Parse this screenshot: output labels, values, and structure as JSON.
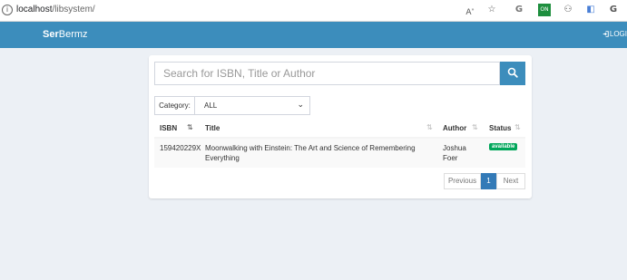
{
  "browser": {
    "url_host": "localhost",
    "url_path": "/libsystem/"
  },
  "navbar": {
    "brand_bold": "Ser",
    "brand_rest": "Bermz",
    "login_label": "LOGI"
  },
  "search": {
    "placeholder": "Search for ISBN, Title or Author"
  },
  "category": {
    "label": "Category:",
    "selected": "ALL"
  },
  "table": {
    "headers": [
      "ISBN",
      "Title",
      "Author",
      "Status"
    ],
    "rows": [
      {
        "isbn": "159420229X",
        "title": "Moonwalking with Einstein: The Art and Science of Remembering Everything",
        "author": "Joshua Foer",
        "status": "available"
      }
    ]
  },
  "pagination": {
    "previous": "Previous",
    "current": "1",
    "next": "Next"
  },
  "colors": {
    "navbar": "#3c8dbc",
    "background": "#ecf0f5",
    "status_available": "#00a65a",
    "page_active": "#337ab7"
  }
}
